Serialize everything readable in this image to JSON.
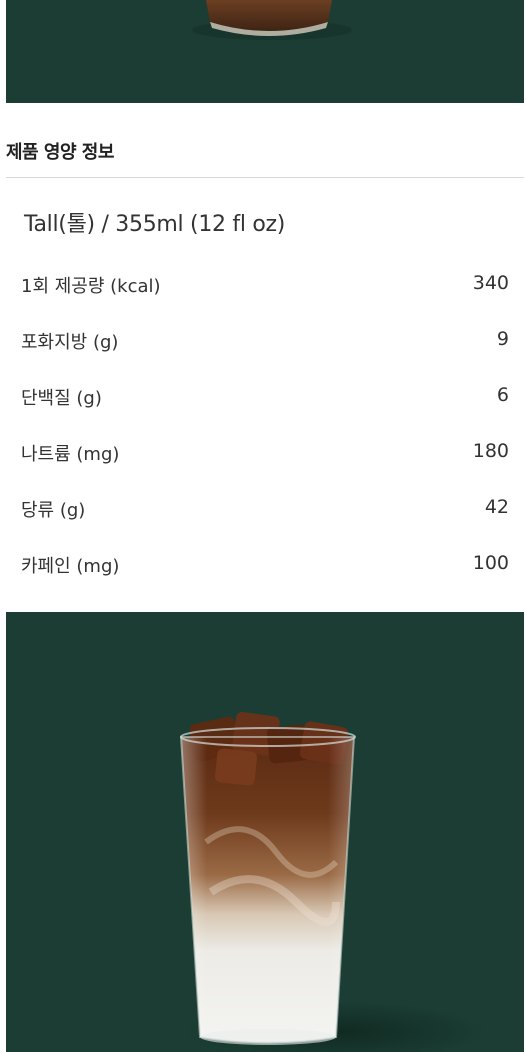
{
  "section": {
    "title": "제품 영양 정보"
  },
  "size": {
    "label": "Tall(톨) / 355ml (12 fl oz)"
  },
  "nutrition": [
    {
      "label": "1회 제공량 (kcal)",
      "value": "340"
    },
    {
      "label": "포화지방 (g)",
      "value": "9"
    },
    {
      "label": "단백질 (g)",
      "value": "6"
    },
    {
      "label": "나트륨 (mg)",
      "value": "180"
    },
    {
      "label": "당류 (g)",
      "value": "42"
    },
    {
      "label": "카페인 (mg)",
      "value": "100"
    }
  ],
  "colors": {
    "hero_background": "#1b3d33",
    "divider": "#d9d9d9"
  }
}
